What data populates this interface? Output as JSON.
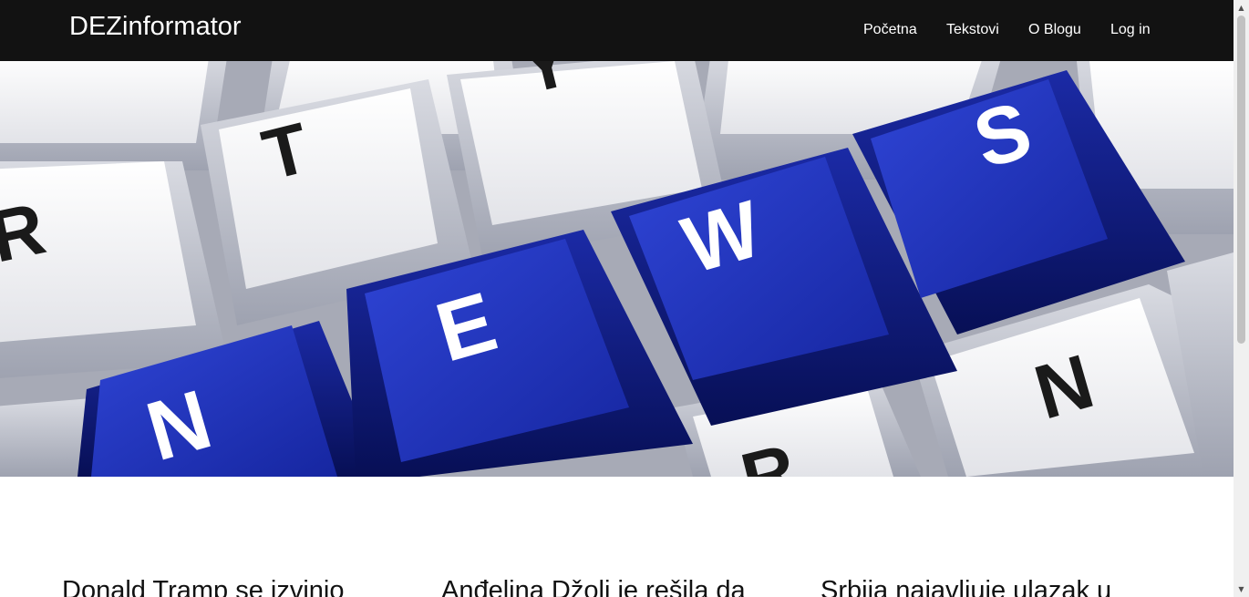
{
  "brand": "DEZinformator",
  "nav": {
    "items": [
      {
        "label": "Početna"
      },
      {
        "label": "Tekstovi"
      },
      {
        "label": "O Blogu"
      },
      {
        "label": "Log in"
      }
    ]
  },
  "hero": {
    "icon": "keyboard-news-image",
    "key_letters": [
      "R",
      "T",
      "Y",
      "N",
      "E",
      "W",
      "S",
      "N",
      "R"
    ]
  },
  "articles": [
    {
      "title": "Donald Tramp se izvinio"
    },
    {
      "title": "Anđelina Džoli je rešila da"
    },
    {
      "title": "Srbija najavljuje ulazak u"
    }
  ],
  "scrollbar": {
    "up_icon": "arrow-up-icon",
    "down_icon": "arrow-down-icon"
  },
  "colors": {
    "navbar": "#121212",
    "key_blue": "#1a2db0",
    "key_white": "#f2f2f2"
  }
}
